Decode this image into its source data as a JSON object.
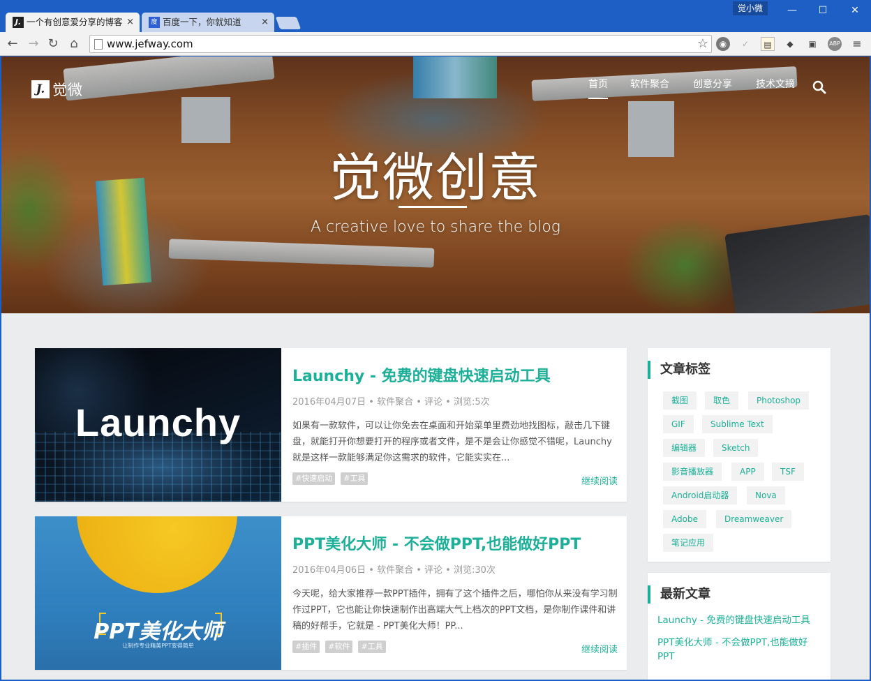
{
  "window": {
    "user_badge": "觉小微",
    "minimize_icon": "minimize-icon",
    "maximize_icon": "maximize-icon",
    "close_icon": "close-icon"
  },
  "tabs": [
    {
      "title": "一个有创意爱分享的博客",
      "favicon": "J.",
      "close": "×"
    },
    {
      "title": "百度一下，你就知道",
      "favicon": "度",
      "close": "×"
    }
  ],
  "toolbar": {
    "url": "www.jefway.com",
    "back": "←",
    "forward": "→",
    "reload": "↻",
    "home": "⌂",
    "star": "☆",
    "extensions": [
      "✓",
      "▤",
      "◆",
      "▣",
      "ABP",
      "≡"
    ]
  },
  "site": {
    "logo_mark": "J.",
    "logo_text": "觉微",
    "nav": [
      "首页",
      "软件聚合",
      "创意分享",
      "技术文摘"
    ],
    "hero_title": "觉微创意",
    "hero_subtitle": "A creative love to share the blog"
  },
  "posts": [
    {
      "thumb_word": "Launchy",
      "title": "Launchy - 免费的键盘快速启动工具",
      "meta": "2016年04月07日 • 软件聚合 • 评论 • 浏览:5次",
      "excerpt": "如果有一款软件，可以让你免去在桌面和开始菜单里费劲地找图标，敲击几下键盘，就能打开你想要打开的程序或者文件，是不是会让你感觉不错呢，Launchy 就是这样一款能够满足你这需求的软件，它能实实在...",
      "tags": [
        "#快速启动",
        "#工具"
      ],
      "read_more": "继续阅读"
    },
    {
      "thumb_word": "PPT美化大师",
      "thumb_caption": "让制作专业精美PPT变得简单",
      "title": "PPT美化大师 - 不会做PPT,也能做好PPT",
      "meta": "2016年04月06日 • 软件聚合 • 评论 • 浏览:30次",
      "excerpt": "今天呢，给大家推荐一款PPT插件，拥有了这个插件之后，哪怕你从来没有学习制作过PPT，它也能让你快速制作出高端大气上档次的PPT文档，是你制作课件和讲稿的好帮手，它就是 - PPT美化大师！PP...",
      "tags": [
        "#插件",
        "#软件",
        "#工具"
      ],
      "read_more": "继续阅读"
    }
  ],
  "sidebar": {
    "tags_title": "文章标签",
    "tags": [
      "截图",
      "取色",
      "Photoshop",
      "GIF",
      "Sublime Text",
      "编辑器",
      "Sketch",
      "影音播放器",
      "APP",
      "TSF",
      "Android启动器",
      "Nova",
      "Adobe",
      "Dreamweaver",
      "笔记应用"
    ],
    "recent_title": "最新文章",
    "recent": [
      "Launchy - 免费的键盘快速启动工具",
      "PPT美化大师 - 不会做PPT,也能做好PPT"
    ]
  },
  "colors": {
    "accent": "#1cb098",
    "chrome_blue": "#1e5fc6",
    "page_bg": "#eaecee"
  }
}
